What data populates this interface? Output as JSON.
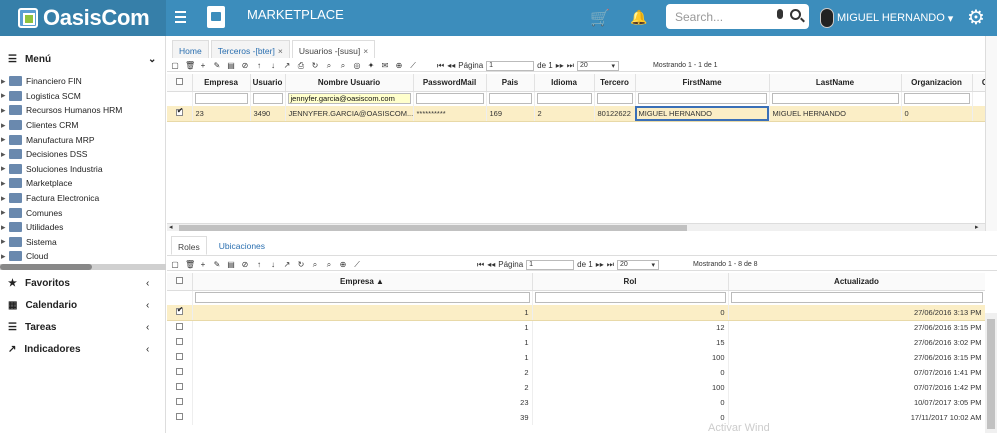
{
  "header": {
    "logo_text": "OasisCom",
    "app_title": "MARKETPLACE",
    "search_placeholder": "Search...",
    "user_name": "MIGUEL HERNANDO"
  },
  "sidebar": {
    "menu_label": "Menú",
    "items": [
      "Financiero FIN",
      "Logistica SCM",
      "Recursos Humanos HRM",
      "Clientes CRM",
      "Manufactura MRP",
      "Decisiones DSS",
      "Soluciones Industria",
      "Marketplace",
      "Factura Electronica",
      "Comunes",
      "Utilidades",
      "Sistema",
      "Cloud"
    ],
    "sections": [
      "Favoritos",
      "Calendario",
      "Tareas",
      "Indicadores"
    ]
  },
  "tabs": [
    "Home",
    "Terceros -[bter]",
    "Usuarios -[susu]"
  ],
  "top_pager": {
    "page_label": "Página",
    "page_value": "1",
    "of": "de 1",
    "rows": "20",
    "showing": "Mostrando 1 - 1 de 1"
  },
  "top_grid": {
    "columns": [
      "Empresa",
      "Usuario",
      "Nombre Usuario",
      "PasswordMail",
      "Pais",
      "Idioma",
      "Tercero",
      "FirstName",
      "LastName",
      "Organizacion",
      "Cre"
    ],
    "filter_value": "jennyfer.garcia@oasiscom.com",
    "row": [
      "23",
      "3490",
      "JENNYFER.GARCIA@OASISCOM....",
      "**********",
      "169",
      "2",
      "80122622",
      "MIGUEL HERNANDO",
      "MIGUEL HERNANDO",
      "0",
      ""
    ]
  },
  "subtabs": [
    "Roles",
    "Ubicaciones"
  ],
  "bottom_pager": {
    "page_label": "Página",
    "page_value": "1",
    "of": "de 1",
    "rows": "20",
    "showing": "Mostrando 1 - 8 de 8"
  },
  "bottom_grid": {
    "columns": [
      "Empresa",
      "Rol",
      "Actualizado"
    ],
    "sort_indicator": "▲",
    "rows": [
      [
        "1",
        "0",
        "27/06/2016 3:13 PM"
      ],
      [
        "1",
        "12",
        "27/06/2016 3:15 PM"
      ],
      [
        "1",
        "15",
        "27/06/2016 3:02 PM"
      ],
      [
        "1",
        "100",
        "27/06/2016 3:15 PM"
      ],
      [
        "2",
        "0",
        "07/07/2016 1:41 PM"
      ],
      [
        "2",
        "100",
        "07/07/2016 1:42 PM"
      ],
      [
        "23",
        "0",
        "10/07/2017 3:05 PM"
      ],
      [
        "39",
        "0",
        "17/11/2017 10:02 AM"
      ]
    ]
  },
  "watermark": "Activar Wind"
}
